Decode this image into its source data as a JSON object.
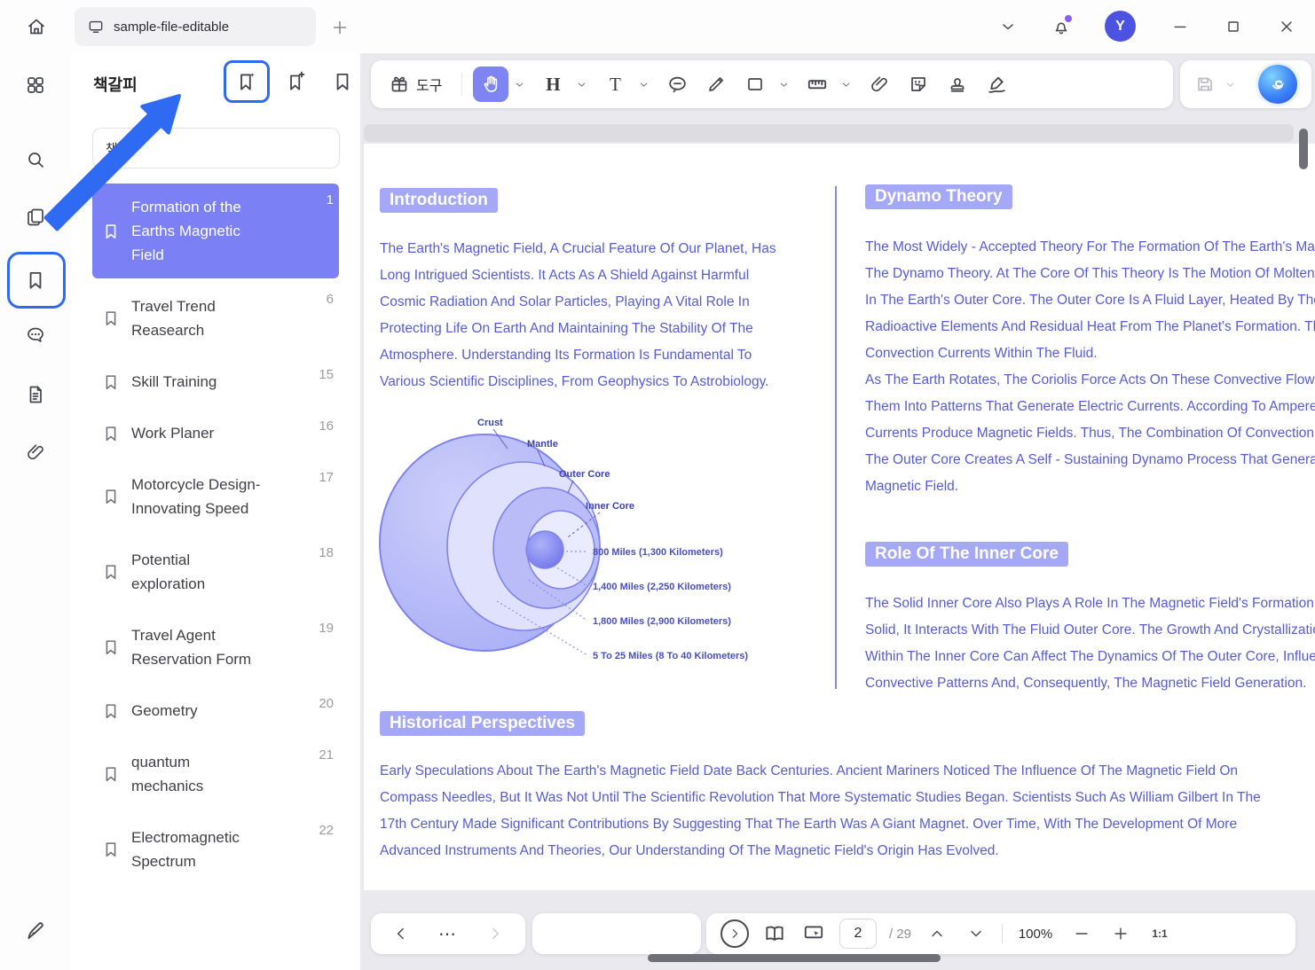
{
  "topbar": {
    "tab_title": "sample-file-editable",
    "avatar_initial": "Y"
  },
  "panel": {
    "title": "책갈피",
    "search_value": "책",
    "items": [
      {
        "label": "Formation of the Earths Magnetic Field",
        "page": "1"
      },
      {
        "label": "Travel Trend Reasearch",
        "page": "6"
      },
      {
        "label": "Skill Training",
        "page": "15"
      },
      {
        "label": "Work Planer",
        "page": "16"
      },
      {
        "label": "Motorcycle Design-Innovating Speed",
        "page": "17"
      },
      {
        "label": "Potential exploration",
        "page": "18"
      },
      {
        "label": "Travel Agent Reservation Form",
        "page": "19"
      },
      {
        "label": "Geometry",
        "page": "20"
      },
      {
        "label": "quantum mechanics",
        "page": "21"
      },
      {
        "label": "Electromagnetic Spectrum",
        "page": "22"
      }
    ]
  },
  "toolbar": {
    "tools_label": "도구",
    "heading_glyph": "H",
    "text_glyph": "T"
  },
  "document": {
    "introduction": {
      "heading": "Introduction",
      "body": "The Earth's Magnetic Field, A Crucial Feature Of Our Planet, Has Long Intrigued Scientists. It Acts As A Shield Against Harmful Cosmic Radiation And Solar Particles, Playing A Vital Role In Protecting Life On Earth And Maintaining The Stability Of The Atmosphere. Understanding Its Formation Is Fundamental To Various Scientific Disciplines, From Geophysics To Astrobiology."
    },
    "dynamo": {
      "heading": "Dynamo Theory",
      "lines": [
        "The Most Widely - Accepted Theory For The Formation Of The Earth's Magnetic Field Is",
        "The Dynamo Theory. At The Core Of This Theory Is The Motion Of Molten Iron Alloys",
        "In The Earth's Outer Core. The Outer Core Is A Fluid Layer, Heated By The Decay Of",
        "Radioactive Elements And Residual Heat From The Planet's Formation. This Heat Drives",
        "Convection Currents Within The Fluid.",
        "As The Earth Rotates, The Coriolis Force Acts On These Convective Flows, Organizing",
        "Them Into Patterns That Generate Electric Currents. According To Ampere's Law, These",
        "Currents Produce Magnetic Fields. Thus, The Combination Of Convection And Rotation In",
        "The Outer Core Creates A Self - Sustaining Dynamo Process That Generates The Earth's",
        "Magnetic Field."
      ]
    },
    "inner_core": {
      "heading": "Role Of The Inner Core",
      "lines": [
        "The Solid Inner Core Also Plays A Role In The Magnetic Field's Formation. Although It Is",
        "Solid, It Interacts With The Fluid Outer Core. The Growth And Crystallization Processes",
        "Within The Inner Core Can Affect The Dynamics Of The Outer Core, Influencing The",
        "Convective Patterns And, Consequently, The Magnetic Field Generation."
      ]
    },
    "historical": {
      "heading": "Historical Perspectives",
      "body": "Early Speculations About The Earth's Magnetic Field Date Back Centuries. Ancient Mariners Noticed The Influence Of The Magnetic Field On Compass Needles, But It Was Not Until The Scientific Revolution That More Systematic Studies Began. Scientists Such As William Gilbert In The 17th Century Made Significant Contributions By Suggesting That The Earth Was A Giant Magnet. Over Time, With The Development Of More Advanced Instruments And Theories, Our Understanding Of The Magnetic Field's Origin Has Evolved."
    },
    "diagram": {
      "crust": "Crust",
      "mantle": "Mantle",
      "outer_core": "Outer Core",
      "inner_core": "Inner Core",
      "m1": "800 Miles (1,300 Kilometers)",
      "m2": "1,400 Miles (2,250 Kilometers)",
      "m3": "1,800 Miles (2,900 Kilometers)",
      "m4": "5 To 25 Miles (8 To 40 Kilometers)"
    }
  },
  "statusbar": {
    "more_glyph": "⋯",
    "page_current": "2",
    "page_total": "/ 29",
    "zoom": "100%",
    "fit": "1:1"
  },
  "colors": {
    "accent": "#7b80f4",
    "annotation_blue": "#2f6bf2",
    "doc_text": "#575cd0"
  }
}
